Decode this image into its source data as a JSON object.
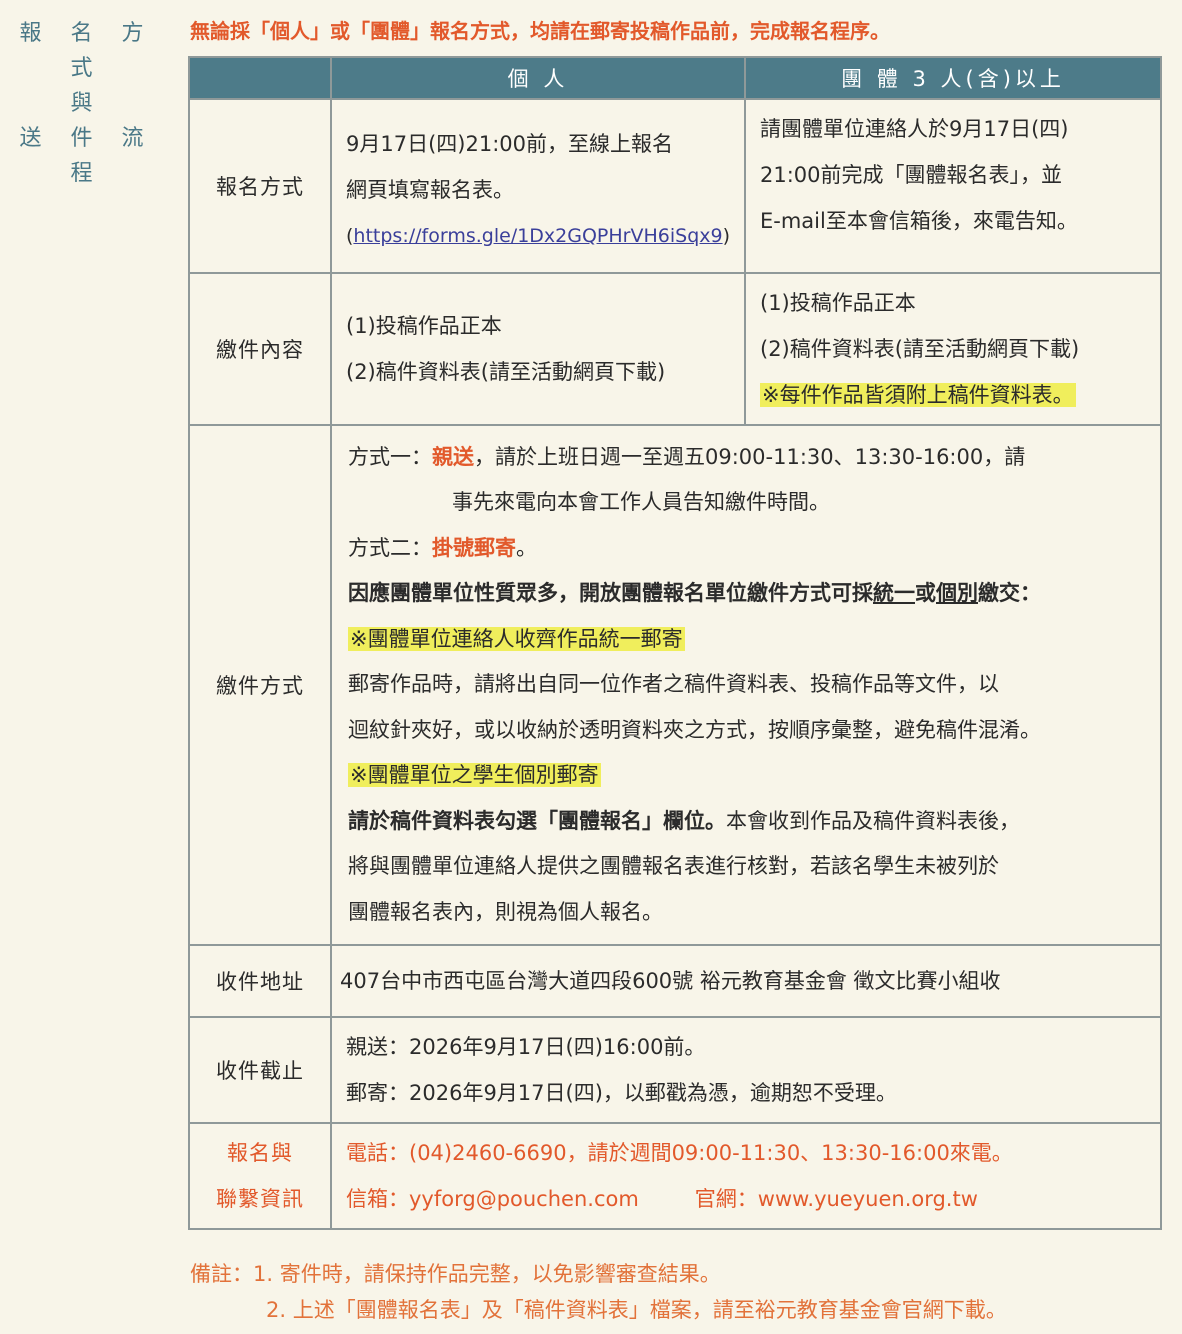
{
  "side_title": {
    "line1": "報 名 方 式",
    "line2": "與",
    "line3": "送 件 流 程"
  },
  "intro": "無論採「個人」或「團體」報名方式，均請在郵寄投稿作品前，完成報名程序。",
  "table": {
    "headers": {
      "individual": "個 人",
      "group": "團 體 3 人(含)以上"
    },
    "registration": {
      "label": "報名方式",
      "individual": {
        "line1": "9月17日(四)21:00前，至線上報名",
        "line2": "網頁填寫報名表。",
        "paren_open": "(",
        "link": "https://forms.gle/1Dx2GQPHrVH6iSqx9",
        "paren_close": ")"
      },
      "group": {
        "line1": "請團體單位連絡人於9月17日(四)",
        "line2": "21:00前完成「團體報名表」，並",
        "line3": "E-mail至本會信箱後，來電告知。"
      }
    },
    "submission_content": {
      "label": "繳件內容",
      "individual": {
        "item1": "(1)投稿作品正本",
        "item2": "(2)稿件資料表(請至活動網頁下載)"
      },
      "group": {
        "item1": "(1)投稿作品正本",
        "item2": "(2)稿件資料表(請至活動網頁下載)",
        "note": "※每件作品皆須附上稿件資料表。"
      }
    },
    "submission_method": {
      "label": "繳件方式",
      "m1_prefix": "方式一：",
      "m1_key": "親送",
      "m1_text": "，請於上班日週一至週五09:00-11:30、13:30-16:00，請",
      "m1_line2": "事先來電向本會工作人員告知繳件時間。",
      "m2_prefix": "方式二：",
      "m2_key": "掛號郵寄",
      "m2_end": "。",
      "group_intro_a": "因應團體單位性質眾多，開放團體報名單位繳件方式可採",
      "group_intro_u1": "統一",
      "group_intro_b": "或",
      "group_intro_u2": "個別",
      "group_intro_c": "繳交：",
      "unified_title": "※團體單位連絡人收齊作品統一郵寄",
      "unified_line1": "郵寄作品時，請將出自同一位作者之稿件資料表、投稿作品等文件，以",
      "unified_line2": "迴紋針夾好，或以收納於透明資料夾之方式，按順序彙整，避免稿件混淆。",
      "individual_title": "※團體單位之學生個別郵寄",
      "individual_bold": "請於稿件資料表勾選「團體報名」欄位。",
      "individual_line1": "本會收到作品及稿件資料表後，",
      "individual_line2": "將與團體單位連絡人提供之團體報名表進行核對，若該名學生未被列於",
      "individual_line3": "團體報名表內，則視為個人報名。"
    },
    "address": {
      "label": "收件地址",
      "value": "407台中市西屯區台灣大道四段600號 裕元教育基金會 徵文比賽小組收"
    },
    "deadline": {
      "label": "收件截止",
      "line1": "親送：2026年9月17日(四)16:00前。",
      "line2": "郵寄：2026年9月17日(四)，以郵戳為憑，逾期恕不受理。"
    },
    "contact": {
      "label_line1": "報名與",
      "label_line2": "聯繫資訊",
      "phone": "電話：(04)2460-6690，請於週間09:00-11:30、13:30-16:00來電。",
      "email": "信箱：yyforg@pouchen.com",
      "website": "官網：www.yueyuen.org.tw"
    }
  },
  "notes": {
    "prefix": "備註：",
    "note1": "1. 寄件時，請保持作品完整，以免影響審查結果。",
    "note2": "2. 上述「團體報名表」及「稿件資料表」檔案，請至裕元教育基金會官網下載。"
  },
  "colors": {
    "header_bg": "#4d7b89",
    "accent_orange": "#e2592b",
    "highlight": "#f0ee5c",
    "background": "#f8f5e9"
  }
}
